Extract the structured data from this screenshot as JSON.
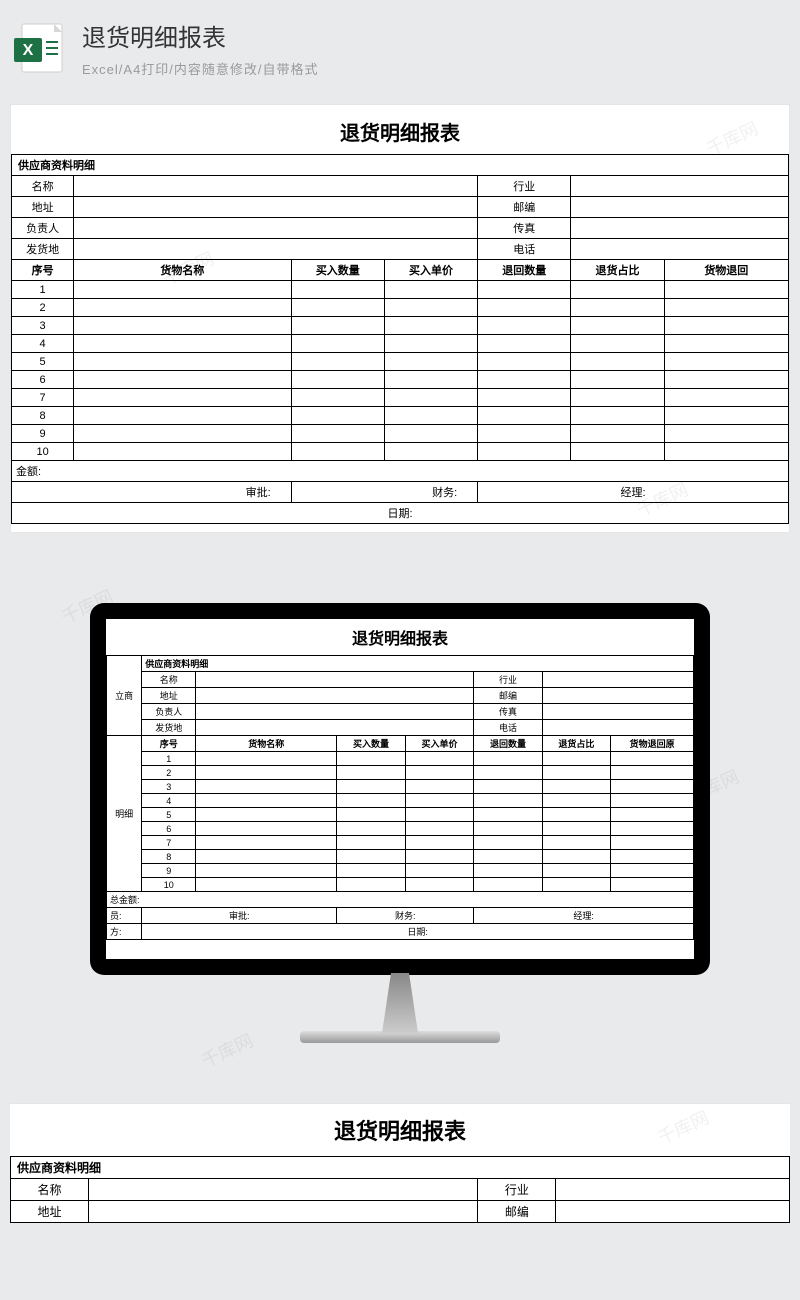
{
  "header": {
    "title": "退货明细报表",
    "subtitle": "Excel/A4打印/内容随意修改/自带格式",
    "icon_label": "X"
  },
  "watermark": "千库网",
  "report": {
    "main_title": "退货明细报表",
    "supplier_section": "供应商资料明细",
    "fields": {
      "name": "名称",
      "industry": "行业",
      "address": "地址",
      "zip": "邮编",
      "manager": "负责人",
      "fax": "传真",
      "ship_from": "发货地",
      "phone": "电话"
    },
    "columns": {
      "no": "序号",
      "goods_name": "货物名称",
      "qty_in": "买入数量",
      "price_in": "买入单价",
      "qty_return": "退回数量",
      "return_ratio": "退货占比",
      "return_reason": "货物退回原",
      "return_reason_cut": "货物退回"
    },
    "rows": [
      "1",
      "2",
      "3",
      "4",
      "5",
      "6",
      "7",
      "8",
      "9",
      "10"
    ],
    "labels": {
      "amount": "金额:",
      "total_amount": "总金额:",
      "approve": "审批:",
      "finance": "财务:",
      "manager_sig": "经理:",
      "date": "日期:",
      "side_supplier": "立商",
      "side_detail": "明细",
      "side_person": "员:",
      "side_side": "方:"
    }
  }
}
